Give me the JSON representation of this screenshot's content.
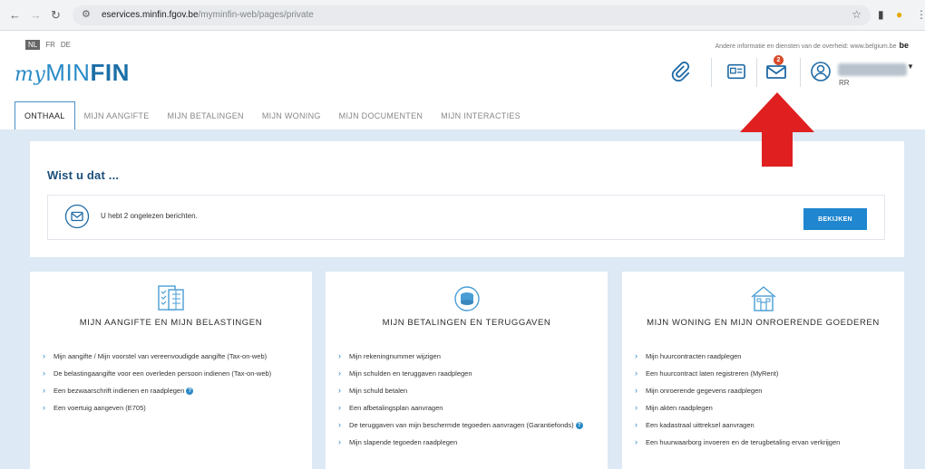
{
  "browser": {
    "url_host": "eservices.minfin.fgov.be",
    "url_path": "/myminfin-web/pages/private",
    "back_icon": "arrow-left",
    "forward_icon": "arrow-right",
    "reload_icon": "reload",
    "tune_icon": "tune",
    "bookmark_icon": "star"
  },
  "header": {
    "languages": [
      "NL",
      "FR",
      "DE"
    ],
    "active_language": "NL",
    "top_link": "Andere informatie en diensten van de overheid: www.belgium.be",
    "top_link_brand": "be",
    "logo_my": "my",
    "logo_min": "MIN",
    "logo_fin": "FIN",
    "mail_badge": "2",
    "user_initials": "RR"
  },
  "tabs": [
    {
      "label": "ONTHAAL",
      "active": true
    },
    {
      "label": "MIJN AANGIFTE"
    },
    {
      "label": "MIJN BETALINGEN"
    },
    {
      "label": "MIJN WONING"
    },
    {
      "label": "MIJN DOCUMENTEN"
    },
    {
      "label": "MIJN INTERACTIES"
    }
  ],
  "wist": {
    "title": "Wist u dat ...",
    "message": "U hebt 2 ongelezen berichten.",
    "button": "BEKIJKEN"
  },
  "cards": [
    {
      "title": "MIJN AANGIFTE EN MIJN BELASTINGEN",
      "items": [
        "Mijn aangifte / Mijn voorstel van vereenvoudigde aangifte (Tax-on-web)",
        "De belastingaangifte voor een overleden persoon indienen (Tax-on-web)",
        "Een bezwaarschrift indienen en raadplegen",
        "Een voertuig aangeven (E705)"
      ]
    },
    {
      "title": "MIJN BETALINGEN EN TERUGGAVEN",
      "items": [
        "Mijn rekeningnummer wijzigen",
        "Mijn schulden en teruggaven raadplegen",
        "Mijn schuld betalen",
        "Een afbetalingsplan aanvragen",
        "De teruggaven van mijn beschermde tegoeden aanvragen (Garantiefonds)",
        "Mijn slapende tegoeden raadplegen"
      ]
    },
    {
      "title": "MIJN WONING EN MIJN ONROERENDE GOEDEREN",
      "items": [
        "Mijn huurcontracten raadplegen",
        "Een huurcontract laten registreren (MyRent)",
        "Mijn onroerende gegevens raadplegen",
        "Mijn akten raadplegen",
        "Een kadastraal uittreksel aanvragen",
        "Een huurwaarborg invoeren en de terugbetaling ervan verkrijgen"
      ]
    }
  ],
  "colors": {
    "brand": "#2a8ac6",
    "button": "#1f86cf",
    "background": "#dde9f4",
    "annotation_arrow": "#e02020"
  }
}
